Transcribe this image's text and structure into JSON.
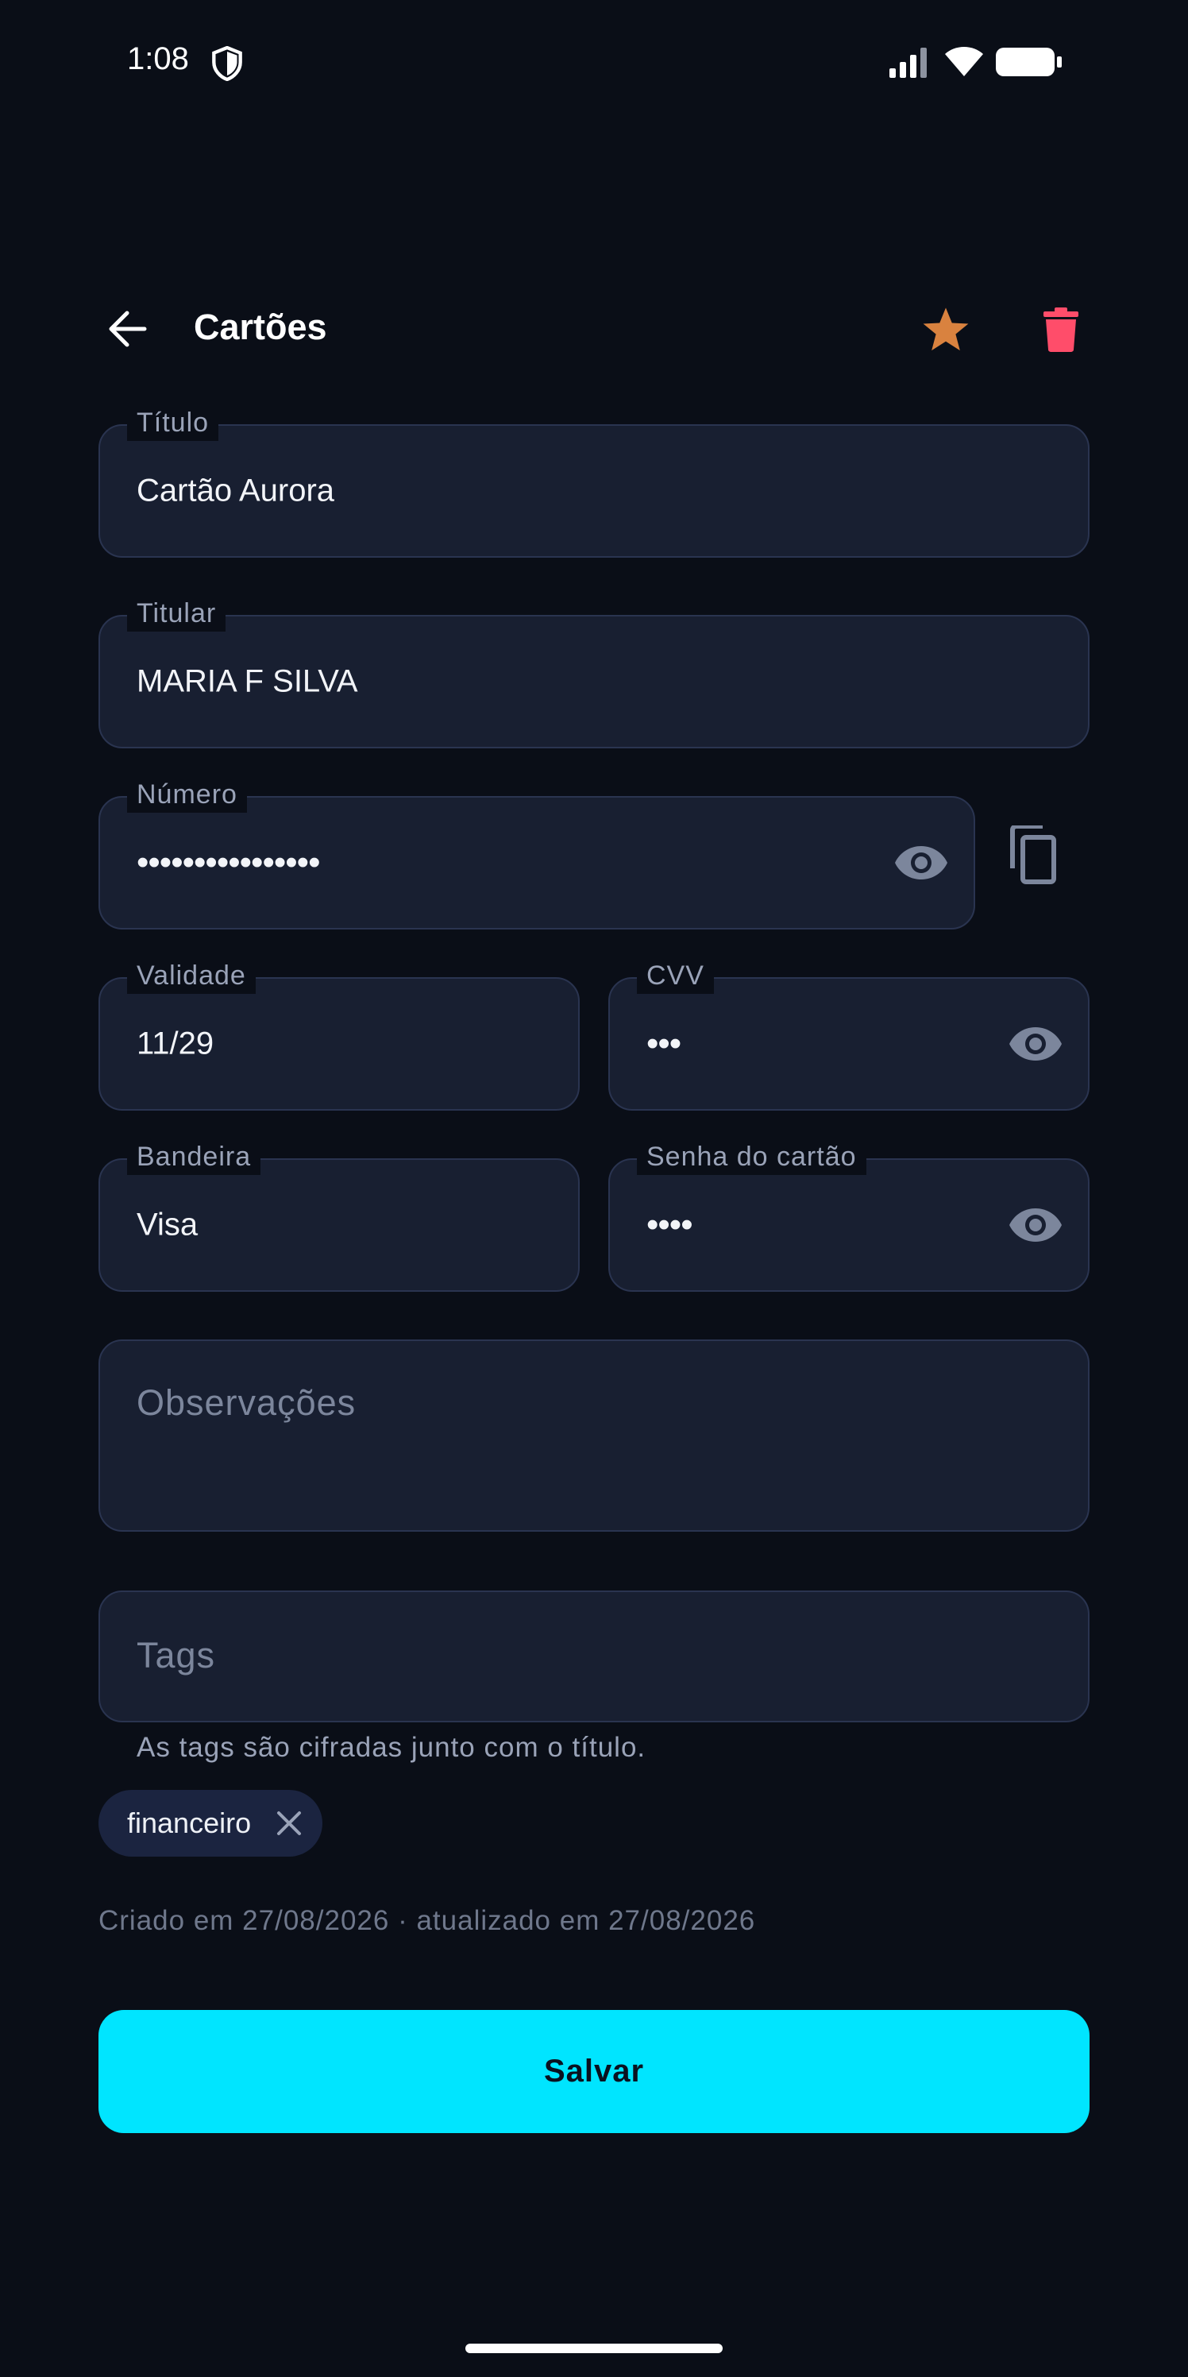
{
  "status_bar": {
    "time": "1:08"
  },
  "app_bar": {
    "title": "Cartões"
  },
  "fields": {
    "titulo": {
      "label": "Título",
      "value": "Cartão Aurora"
    },
    "titular": {
      "label": "Titular",
      "value": "MARIA F SILVA"
    },
    "numero": {
      "label": "Número",
      "value": "••••••••••••••••"
    },
    "validade": {
      "label": "Validade",
      "value": "11/29"
    },
    "cvv": {
      "label": "CVV",
      "value": "•••"
    },
    "bandeira": {
      "label": "Bandeira",
      "value": "Visa"
    },
    "senha": {
      "label": "Senha do cartão",
      "value": "••••"
    },
    "observacoes": {
      "placeholder": "Observações"
    },
    "tags": {
      "placeholder": "Tags",
      "helper": "As tags são cifradas junto com o título."
    }
  },
  "tag_chips": [
    {
      "label": "financeiro"
    }
  ],
  "meta": "Criado em 27/08/2026 · atualizado em 27/08/2026",
  "save_label": "Salvar",
  "colors": {
    "accent": "#00e5ff",
    "star": "#d9823f",
    "delete": "#ff4d6a",
    "background": "#0a0e17",
    "field": "#181f31"
  },
  "icons": [
    "shield-icon",
    "signal-icon",
    "wifi-icon",
    "battery-icon",
    "back-arrow-icon",
    "star-icon",
    "trash-icon",
    "eye-icon",
    "copy-icon",
    "close-icon"
  ]
}
